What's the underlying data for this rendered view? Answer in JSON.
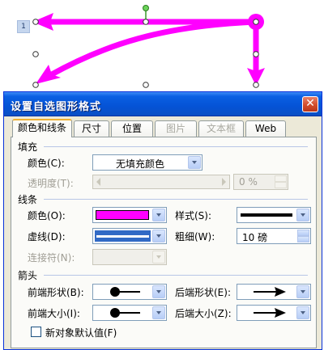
{
  "page_marker": "1",
  "dialog": {
    "title": "设置自选图形格式",
    "close_symbol": "✕",
    "tabs": [
      {
        "label": "颜色和线条",
        "active": true,
        "enabled": true
      },
      {
        "label": "尺寸",
        "active": false,
        "enabled": true
      },
      {
        "label": "位置",
        "active": false,
        "enabled": true
      },
      {
        "label": "图片",
        "active": false,
        "enabled": false
      },
      {
        "label": "文本框",
        "active": false,
        "enabled": false
      },
      {
        "label": "Web",
        "active": false,
        "enabled": true
      }
    ],
    "fill": {
      "section_label": "填充",
      "color_label": "颜色(C):",
      "color_value": "无填充颜色",
      "transparency_label": "透明度(T):",
      "transparency_value": "0 %"
    },
    "line": {
      "section_label": "线条",
      "color_label": "颜色(O):",
      "color_value": "#ff00ff",
      "style_label": "样式(S):",
      "dash_label": "虚线(D):",
      "weight_label": "粗细(W):",
      "weight_value": "10 磅",
      "connector_label": "连接符(N):",
      "selected_highlight": "#316ac5"
    },
    "arrows": {
      "section_label": "箭头",
      "begin_style_label": "前端形状(B):",
      "end_style_label": "后端形状(E):",
      "begin_size_label": "前端大小(I):",
      "end_size_label": "后端大小(Z):"
    },
    "default_checkbox_label": "新对象默认值(F)"
  },
  "colors": {
    "shape_line": "#ff00ff",
    "dialog_face": "#ece9d8",
    "titlebar": "#0553d6",
    "close_button": "#d34d2b"
  },
  "icons": [
    "close-icon",
    "dropdown-arrow-icon",
    "spin-up-icon",
    "spin-down-icon",
    "dot-arrow-icon",
    "arrow-head-icon"
  ]
}
